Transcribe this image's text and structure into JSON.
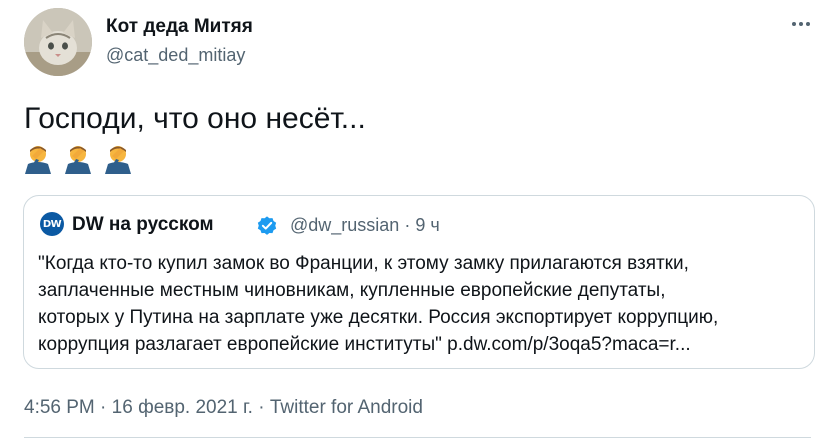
{
  "author": {
    "display_name": "Кот деда Митяя",
    "handle": "@cat_ded_mitiay",
    "avatar_icon": "cat-photo"
  },
  "tweet": {
    "text": "Господи, что оно несёт...",
    "emojis": [
      "face-palm-icon",
      "face-palm-icon",
      "face-palm-icon"
    ]
  },
  "quote": {
    "avatar_label": "DW",
    "name": "DW на русском",
    "verified_icon": "verified-badge-icon",
    "handle": "@dw_russian",
    "separator": "·",
    "time": "9 ч",
    "text": "\"Когда кто-то купил замок во Франции, к этому замку прилагаются взятки,\nзаплаченные местным чиновникам, купленные европейские депутаты,\nкоторых у Путина на зарплате уже десятки. Россия экспортирует коррупцию,\nкоррупция разлагает европейские институты\" p.dw.com/p/3oqa5?maca=r..."
  },
  "footer": {
    "time": "4:56 PM",
    "sep1": "·",
    "date": "16 февр. 2021 г.",
    "sep2": "·",
    "source": "Twitter for Android"
  },
  "colors": {
    "text": "#0f1419",
    "secondary": "#536471",
    "border": "#cfd9de",
    "verified": "#1d9bf0",
    "dw_blue": "#0b59a3",
    "emoji_skin": "#f7b63f",
    "emoji_sleeve": "#2f5f8c"
  }
}
